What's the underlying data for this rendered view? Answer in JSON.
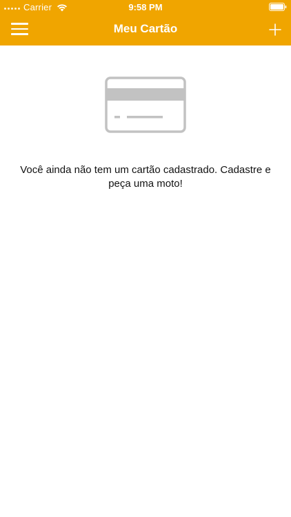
{
  "status_bar": {
    "carrier": "Carrier",
    "time": "9:58 PM",
    "signal_icon": "signal-dots-icon",
    "wifi_icon": "wifi-icon",
    "battery_icon": "battery-icon"
  },
  "nav_bar": {
    "title": "Meu Cartão",
    "menu_icon": "hamburger-menu-icon",
    "add_icon": "plus-icon",
    "background_color": "#f0a500"
  },
  "empty_state": {
    "illustration_icon": "credit-card-icon",
    "message": "Você ainda não tem um cartão cadastrado. Cadastre e peça uma moto!"
  }
}
